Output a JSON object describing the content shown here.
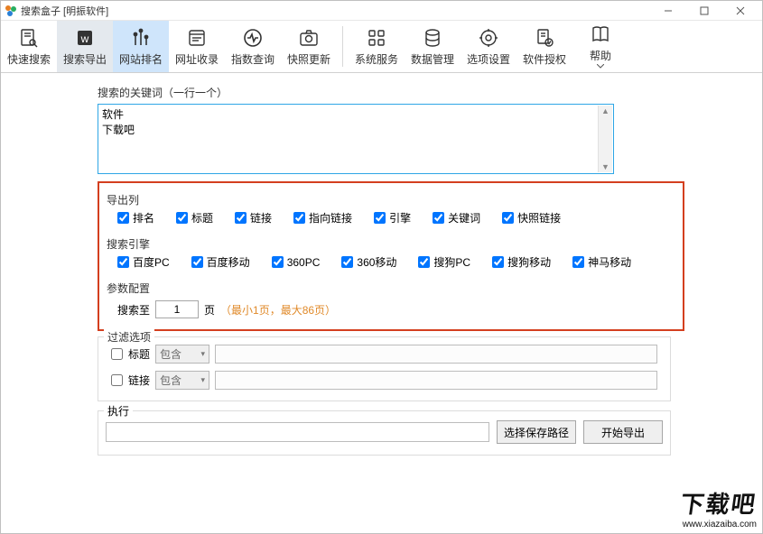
{
  "title": "搜索盒子  [明振软件]",
  "toolbar": [
    {
      "label": "快速搜索"
    },
    {
      "label": "搜索导出"
    },
    {
      "label": "网站排名"
    },
    {
      "label": "网址收录"
    },
    {
      "label": "指数查询"
    },
    {
      "label": "快照更新"
    },
    {
      "label": "系统服务"
    },
    {
      "label": "数据管理"
    },
    {
      "label": "选项设置"
    },
    {
      "label": "软件授权"
    },
    {
      "label": "帮助"
    }
  ],
  "keyword": {
    "label": "搜索的关键词（一行一个）",
    "value": "软件\n下载吧"
  },
  "export_columns": {
    "title": "导出列",
    "items": [
      "排名",
      "标题",
      "链接",
      "指向链接",
      "引擎",
      "关键词",
      "快照链接"
    ]
  },
  "engines": {
    "title": "搜索引擎",
    "items": [
      "百度PC",
      "百度移动",
      "360PC",
      "360移动",
      "搜狗PC",
      "搜狗移动",
      "神马移动"
    ]
  },
  "params": {
    "title": "参数配置",
    "pre": "搜索至",
    "value": "1",
    "post": "页",
    "hint": "（最小1页，最大86页）"
  },
  "filter": {
    "title": "过滤选项",
    "row1_label": "标题",
    "row2_label": "链接",
    "combo": "包含"
  },
  "exec": {
    "title": "执行",
    "choose": "选择保存路径",
    "start": "开始导出"
  },
  "watermark": {
    "brand": "下载吧",
    "url": "www.xiazaiba.com"
  }
}
